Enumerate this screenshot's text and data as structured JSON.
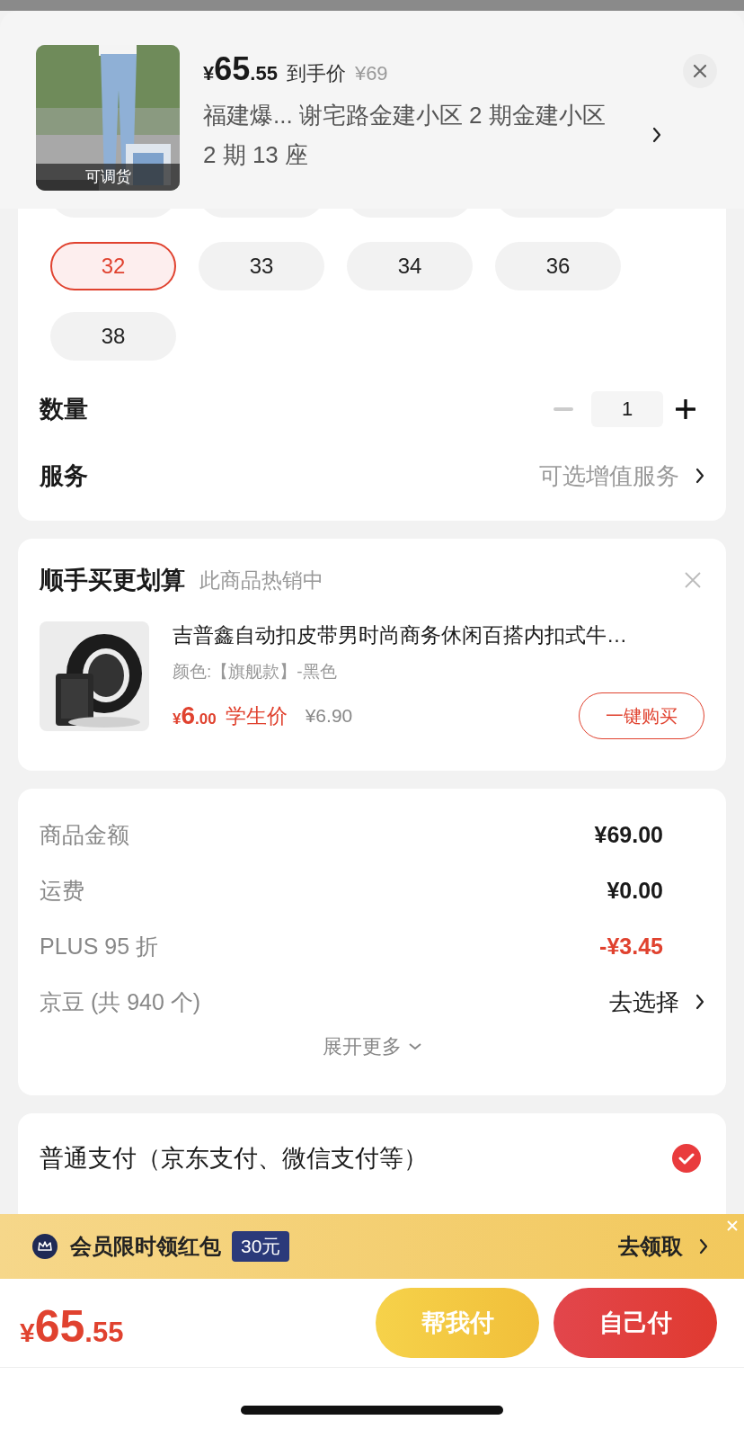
{
  "header": {
    "image_badge": "可调货",
    "price": {
      "currency": "¥",
      "integer": "65",
      "decimal": ".55"
    },
    "price_label": "到手价",
    "original_price": "¥69",
    "address": "福建爆...  谢宅路金建小区 2 期金建小区 2 期 13 座"
  },
  "sizes": [
    {
      "label": "32",
      "selected": true
    },
    {
      "label": "33",
      "selected": false
    },
    {
      "label": "34",
      "selected": false
    },
    {
      "label": "36",
      "selected": false
    },
    {
      "label": "38",
      "selected": false
    }
  ],
  "quantity": {
    "label": "数量",
    "value": "1",
    "decrease_disabled": true
  },
  "service": {
    "label": "服务",
    "value": "可选增值服务"
  },
  "addon": {
    "title": "顺手买更划算",
    "subtitle": "此商品热销中",
    "product": {
      "name": "吉普鑫自动扣皮带男时尚商务休闲百搭内扣式牛…",
      "variant": "颜色:【旗舰款】-黑色",
      "price": {
        "currency": "¥",
        "integer": "6",
        "decimal": ".00"
      },
      "price_label": "学生价",
      "original_price": "¥6.90",
      "button": "一键购买"
    }
  },
  "summary": {
    "rows": [
      {
        "label": "商品金额",
        "value": "¥69.00",
        "kind": "amount"
      },
      {
        "label": "运费",
        "value": "¥0.00",
        "kind": "amount"
      },
      {
        "label": "PLUS 95 折",
        "value": "-¥3.45",
        "kind": "discount"
      },
      {
        "label": "京豆 (共 940 个)",
        "value": "去选择",
        "kind": "link"
      }
    ],
    "expand": "展开更多"
  },
  "payment": [
    {
      "label": "普通支付（京东支付、微信支付等）",
      "selected": true
    }
  ],
  "banner": {
    "text": "会员限时领红包",
    "badge": "30元",
    "action": "去领取"
  },
  "bottom_bar": {
    "price": {
      "currency": "¥",
      "integer": "65",
      "decimal": ".55"
    },
    "buttons": [
      {
        "label": "帮我付",
        "kind": "secondary"
      },
      {
        "label": "自己付",
        "kind": "primary"
      }
    ]
  }
}
